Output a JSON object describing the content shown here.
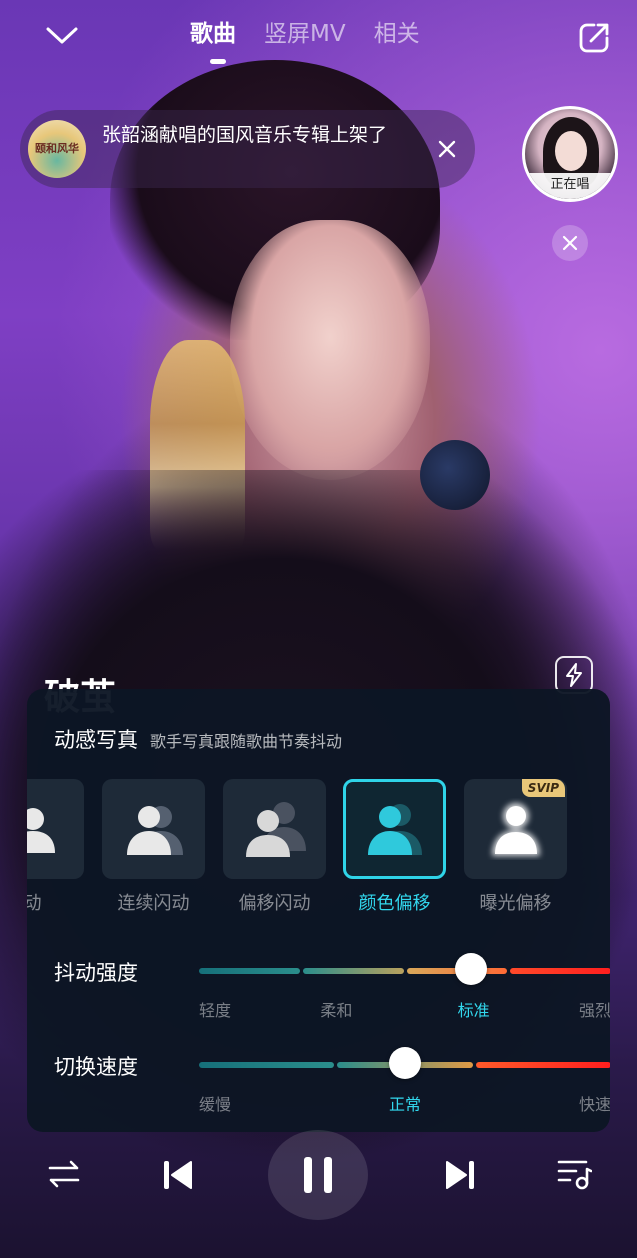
{
  "tabs": [
    {
      "label": "歌曲",
      "active": true
    },
    {
      "label": "竖屏MV",
      "active": false
    },
    {
      "label": "相关",
      "active": false
    }
  ],
  "banner": {
    "album_text": "颐和风华",
    "text": "张韶涵献唱的国风音乐专辑上架了"
  },
  "live": {
    "label": "正在唱"
  },
  "song": {
    "title": "破茧"
  },
  "panel": {
    "title": "动感写真",
    "subtitle": "歌手写真跟随歌曲节奏抖动",
    "effects": [
      {
        "label": "动",
        "selected": false,
        "badge": ""
      },
      {
        "label": "连续闪动",
        "selected": false,
        "badge": ""
      },
      {
        "label": "偏移闪动",
        "selected": false,
        "badge": ""
      },
      {
        "label": "颜色偏移",
        "selected": true,
        "badge": ""
      },
      {
        "label": "曝光偏移",
        "selected": false,
        "badge": "SVIP"
      }
    ],
    "intensity": {
      "label": "抖动强度",
      "options": [
        "轻度",
        "柔和",
        "标准",
        "强烈"
      ],
      "selected": "标准",
      "value": 0.66
    },
    "speed": {
      "label": "切换速度",
      "options": [
        "缓慢",
        "正常",
        "快速"
      ],
      "selected": "正常",
      "value": 0.5
    }
  },
  "colors": {
    "accent": "#32d8ee",
    "track_start": "#1a7a85",
    "track_mid": "#e0b060",
    "track_end": "#ff2a2a",
    "svip": "#e9c779"
  },
  "icons": [
    "chevron-down-icon",
    "share-icon",
    "close-icon",
    "flash-icon",
    "shuffle-icon",
    "previous-icon",
    "pause-icon",
    "next-icon",
    "playlist-icon"
  ]
}
